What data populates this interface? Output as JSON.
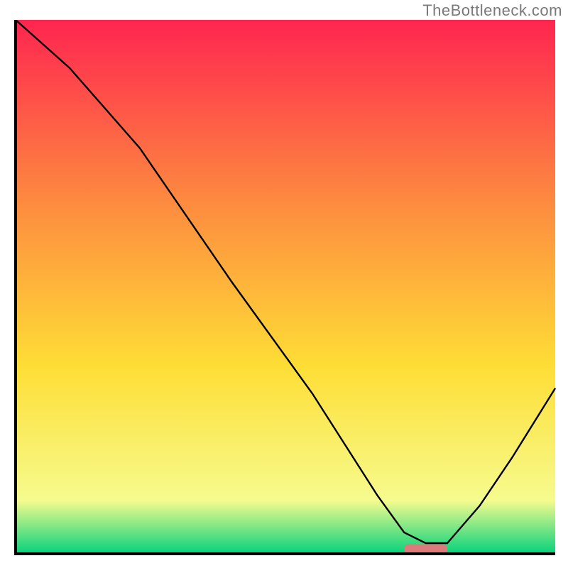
{
  "watermark": "TheBottleneck.com",
  "chart_data": {
    "type": "line",
    "title": "",
    "xlabel": "",
    "ylabel": "",
    "xlim": [
      0,
      100
    ],
    "ylim": [
      0,
      100
    ],
    "grid": false,
    "legend": false,
    "series": [
      {
        "name": "curve",
        "x": [
          0,
          10,
          23,
          40,
          55,
          67,
          72,
          76,
          80,
          86,
          92,
          100
        ],
        "y": [
          100,
          91,
          76,
          51,
          30,
          11,
          4,
          2,
          2,
          9,
          18,
          31
        ]
      }
    ],
    "marker": {
      "x_start": 72,
      "x_end": 80,
      "y": 1,
      "color": "#dd7a7b"
    },
    "background_gradient": {
      "top": "#fe2550",
      "mid": "#fede36",
      "bottom": "#05d27c"
    },
    "axis_stroke": "#000000",
    "curve_stroke": "#000000",
    "curve_width": 2.4
  }
}
